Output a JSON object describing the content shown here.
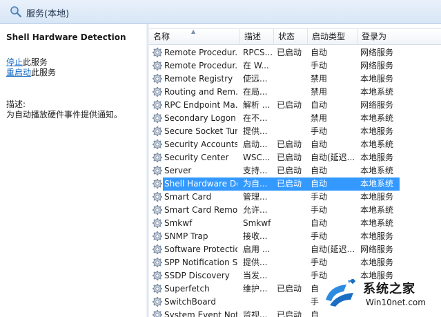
{
  "header": {
    "title": "服务(本地)",
    "icon": "search-icon"
  },
  "detail": {
    "service_name": "Shell Hardware Detection",
    "actions": [
      {
        "link": "停止",
        "suffix": "此服务"
      },
      {
        "link": "重启动",
        "suffix": "此服务"
      }
    ],
    "description_label": "描述:",
    "description": "为自动播放硬件事件提供通知。"
  },
  "table": {
    "columns": [
      "名称",
      "描述",
      "状态",
      "启动类型",
      "登录为"
    ],
    "sorted_column": "名称",
    "rows": [
      {
        "name": "Remote Procedur...",
        "desc": "RPCS...",
        "status": "已启动",
        "startup": "自动",
        "logon": "网络服务"
      },
      {
        "name": "Remote Procedur...",
        "desc": "在 W...",
        "status": "",
        "startup": "手动",
        "logon": "网络服务"
      },
      {
        "name": "Remote Registry",
        "desc": "使远...",
        "status": "",
        "startup": "禁用",
        "logon": "本地服务"
      },
      {
        "name": "Routing and Rem...",
        "desc": "在局...",
        "status": "",
        "startup": "禁用",
        "logon": "本地系统"
      },
      {
        "name": "RPC Endpoint Ma...",
        "desc": "解析 ...",
        "status": "已启动",
        "startup": "自动",
        "logon": "网络服务"
      },
      {
        "name": "Secondary Logon",
        "desc": "在不...",
        "status": "",
        "startup": "禁用",
        "logon": "本地系统"
      },
      {
        "name": "Secure Socket Tun...",
        "desc": "提供...",
        "status": "",
        "startup": "手动",
        "logon": "本地服务"
      },
      {
        "name": "Security Accounts...",
        "desc": "启动...",
        "status": "已启动",
        "startup": "自动",
        "logon": "本地系统"
      },
      {
        "name": "Security Center",
        "desc": "WSC...",
        "status": "已启动",
        "startup": "自动(延迟...",
        "logon": "本地服务"
      },
      {
        "name": "Server",
        "desc": "支持...",
        "status": "已启动",
        "startup": "自动",
        "logon": "本地系统"
      },
      {
        "name": "Shell Hardware De...",
        "desc": "为自...",
        "status": "已启动",
        "startup": "自动",
        "logon": "本地系统"
      },
      {
        "name": "Smart Card",
        "desc": "管理...",
        "status": "",
        "startup": "手动",
        "logon": "本地服务"
      },
      {
        "name": "Smart Card Remo...",
        "desc": "允许...",
        "status": "",
        "startup": "手动",
        "logon": "本地系统"
      },
      {
        "name": "Smkwf",
        "desc": "Smkwf",
        "status": "",
        "startup": "自动",
        "logon": "本地系统"
      },
      {
        "name": "SNMP Trap",
        "desc": "接收...",
        "status": "",
        "startup": "手动",
        "logon": "本地服务"
      },
      {
        "name": "Software Protection",
        "desc": "启用 ...",
        "status": "",
        "startup": "自动(延迟...",
        "logon": "网络服务"
      },
      {
        "name": "SPP Notification S...",
        "desc": "提供...",
        "status": "",
        "startup": "手动",
        "logon": "本地服务"
      },
      {
        "name": "SSDP Discovery",
        "desc": "当发...",
        "status": "",
        "startup": "手动",
        "logon": "本地服务"
      },
      {
        "name": "Superfetch",
        "desc": "维护...",
        "status": "已启动",
        "startup": "自",
        "logon": ""
      },
      {
        "name": "SwitchBoard",
        "desc": "",
        "status": "",
        "startup": "手",
        "logon": ""
      },
      {
        "name": "System Event Noti...",
        "desc": "监视...",
        "status": "已启动",
        "startup": "自",
        "logon": ""
      }
    ],
    "selected_index": 10,
    "selection_color": "#3399ff"
  },
  "watermark": {
    "title": "系统之家",
    "url": "Win10net.com"
  }
}
